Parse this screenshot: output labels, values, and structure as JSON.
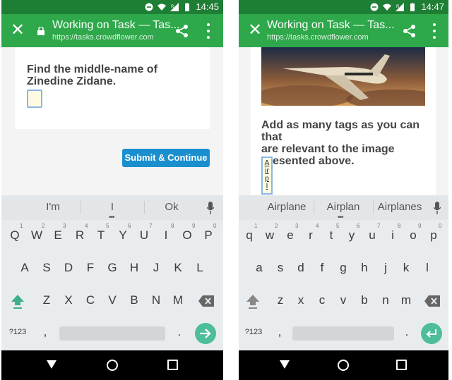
{
  "left": {
    "status": {
      "time": "14:45",
      "network": "R"
    },
    "toolbar": {
      "title": "Working on Task — Tas...",
      "url": "https://tasks.crowdflower.com"
    },
    "question": {
      "line1": "Find the middle-name of",
      "line2": "Zinedine Zidane."
    },
    "submit_label": "Submit & Continue",
    "suggestions": [
      "I'm",
      "I",
      "Ok"
    ],
    "rows": {
      "row1": [
        "Q",
        "W",
        "E",
        "R",
        "T",
        "Y",
        "U",
        "I",
        "O",
        "P"
      ],
      "hints": [
        "1",
        "2",
        "3",
        "4",
        "5",
        "6",
        "7",
        "8",
        "9",
        "0"
      ],
      "row2": [
        "A",
        "S",
        "D",
        "F",
        "G",
        "H",
        "J",
        "K",
        "L"
      ],
      "row3": [
        "Z",
        "X",
        "C",
        "V",
        "B",
        "N",
        "M"
      ],
      "sym": "?123",
      "comma": ",",
      "period": "."
    }
  },
  "right": {
    "status": {
      "time": "14:47",
      "network": "R"
    },
    "toolbar": {
      "title": "Working on Task — Tas...",
      "url": "https://tasks.crowdflower.com"
    },
    "question": {
      "line1": "Add as many tags as you can that",
      "line2": "are relevant to the image",
      "line3": "presented above."
    },
    "tag_chars": [
      "A",
      "ir",
      "p",
      "l"
    ],
    "suggestions": [
      "Airplane",
      "Airplan",
      "Airplanes"
    ],
    "rows": {
      "row1": [
        "q",
        "w",
        "e",
        "r",
        "t",
        "y",
        "u",
        "i",
        "o",
        "p"
      ],
      "hints": [
        "1",
        "2",
        "3",
        "4",
        "5",
        "6",
        "7",
        "8",
        "9",
        "0"
      ],
      "row2": [
        "a",
        "s",
        "d",
        "f",
        "g",
        "h",
        "j",
        "k",
        "l"
      ],
      "row3": [
        "z",
        "x",
        "c",
        "v",
        "b",
        "n",
        "m"
      ],
      "sym": "?123",
      "comma": ",",
      "period": "."
    }
  },
  "icons": [
    "close-icon",
    "lock-icon",
    "share-icon",
    "more-vert-icon",
    "mic-icon",
    "shift-icon",
    "backspace-icon",
    "enter-arrow-icon",
    "nav-back-icon",
    "nav-home-icon",
    "nav-recent-icon"
  ],
  "colors": {
    "toolbar": "#2ea84a",
    "statusbar": "#1e7e34",
    "submit": "#1a8fce",
    "enter_key": "#4dbd9c"
  }
}
